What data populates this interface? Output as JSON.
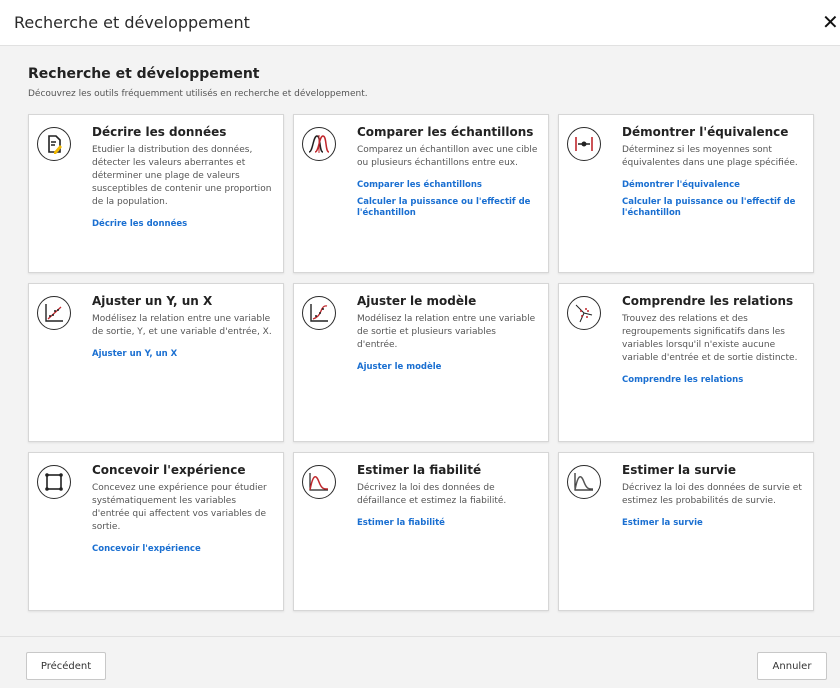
{
  "window": {
    "title": "Recherche et développement",
    "close_symbol": "✕"
  },
  "header": {
    "title": "Recherche et développement",
    "subtitle": "Découvrez les outils fréquemment utilisés en recherche et développement."
  },
  "cards": [
    {
      "title": "Décrire les données",
      "desc": "Etudier la distribution des données, détecter les valeurs aberrantes et déterminer une plage de valeurs susceptibles de contenir une proportion de la population.",
      "links": [
        "Décrire les données"
      ]
    },
    {
      "title": "Comparer les échantillons",
      "desc": "Comparez un échantillon avec une cible ou plusieurs échantillons entre eux.",
      "links": [
        "Comparer les échantillons",
        "Calculer la puissance ou l'effectif de l'échantillon"
      ]
    },
    {
      "title": "Démontrer l'équivalence",
      "desc": "Déterminez si les moyennes sont équivalentes dans une plage spécifiée.",
      "links": [
        "Démontrer l'équivalence",
        "Calculer la puissance ou l'effectif de l'échantillon"
      ]
    },
    {
      "title": "Ajuster un Y, un X",
      "desc": "Modélisez la relation entre une variable de sortie, Y, et une variable d'entrée, X.",
      "links": [
        "Ajuster un Y, un X"
      ]
    },
    {
      "title": "Ajuster le modèle",
      "desc": "Modélisez la relation entre une variable de sortie et plusieurs variables d'entrée.",
      "links": [
        "Ajuster le modèle"
      ]
    },
    {
      "title": "Comprendre les relations",
      "desc": "Trouvez des relations et des regroupements significatifs dans les variables lorsqu'il n'existe aucune variable d'entrée et de sortie distincte.",
      "links": [
        "Comprendre les relations"
      ]
    },
    {
      "title": "Concevoir l'expérience",
      "desc": "Concevez une expérience pour étudier systématiquement les variables d'entrée qui affectent vos variables de sortie.",
      "links": [
        "Concevoir l'expérience"
      ]
    },
    {
      "title": "Estimer la fiabilité",
      "desc": "Décrivez la loi des données de défaillance et estimez la fiabilité.",
      "links": [
        "Estimer la fiabilité"
      ]
    },
    {
      "title": "Estimer la survie",
      "desc": "Décrivez la loi des données de survie et estimez les probabilités de survie.",
      "links": [
        "Estimer la survie"
      ]
    }
  ],
  "footer": {
    "prev_label": "Précédent",
    "cancel_label": "Annuler"
  },
  "colors": {
    "link": "#1a6fd1",
    "accent_red": "#c0282d",
    "background": "#f3f3f3"
  }
}
